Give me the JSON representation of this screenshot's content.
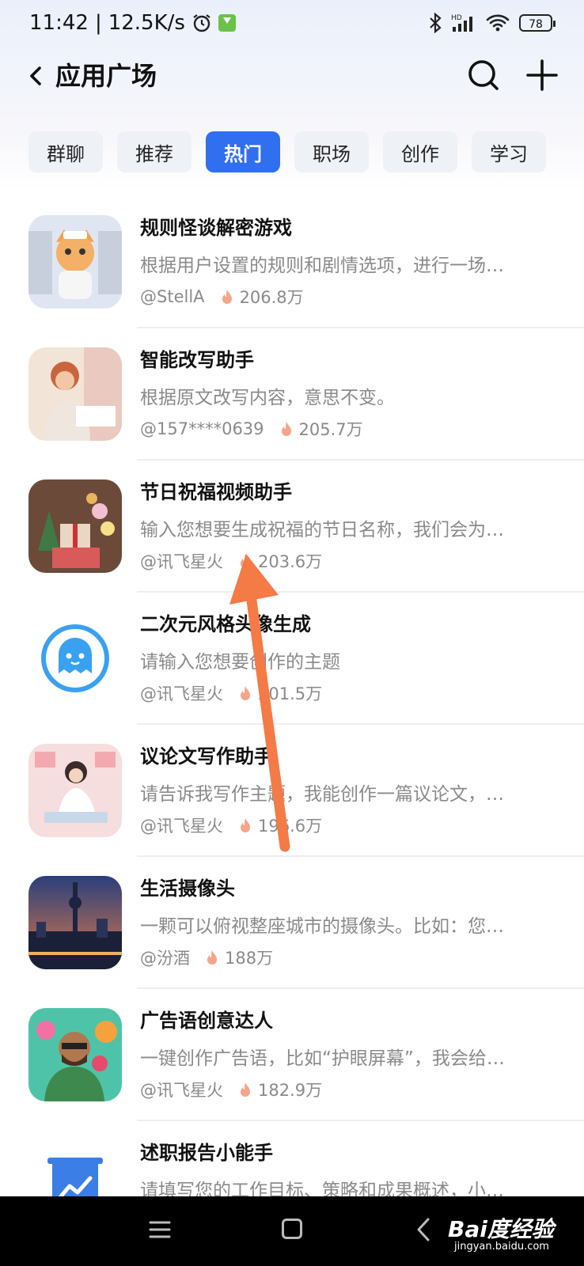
{
  "status_bar": {
    "time": "11:42",
    "net_speed": "12.5K/s",
    "battery": "78",
    "network_label": "HD"
  },
  "header": {
    "title": "应用广场"
  },
  "tabs": [
    {
      "label": "群聊",
      "active": false
    },
    {
      "label": "推荐",
      "active": false
    },
    {
      "label": "热门",
      "active": true
    },
    {
      "label": "职场",
      "active": false
    },
    {
      "label": "创作",
      "active": false
    },
    {
      "label": "学习",
      "active": false
    }
  ],
  "apps": [
    {
      "title": "规则怪谈解密游戏",
      "desc": "根据用户设置的规则和剧情选项，进行一场…",
      "author": "@StellA",
      "heat": "206.8万"
    },
    {
      "title": "智能改写助手",
      "desc": "根据原文改写内容，意思不变。",
      "author": "@157****0639",
      "heat": "205.7万"
    },
    {
      "title": "节日祝福视频助手",
      "desc": "输入您想要生成祝福的节日名称，我们会为…",
      "author": "@讯飞星火",
      "heat": "203.6万"
    },
    {
      "title": "二次元风格头像生成",
      "desc": "请输入您想要创作的主题",
      "author": "@讯飞星火",
      "heat": "201.5万"
    },
    {
      "title": "议论文写作助手",
      "desc": "请告诉我写作主题，我能创作一篇议论文，…",
      "author": "@讯飞星火",
      "heat": "196.6万"
    },
    {
      "title": "生活摄像头",
      "desc": "一颗可以俯视整座城市的摄像头。比如：您…",
      "author": "@汾酒",
      "heat": "188万"
    },
    {
      "title": "广告语创意达人",
      "desc": "一键创作广告语，比如“护眼屏幕”，我会给…",
      "author": "@讯飞星火",
      "heat": "182.9万"
    },
    {
      "title": "述职报告小能手",
      "desc": "请填写您的工作目标、策略和成果概述，小…",
      "author": "",
      "heat": ""
    }
  ],
  "watermark": {
    "brand": "Bai度经验",
    "url": "jingyan.baidu.com"
  },
  "colors": {
    "accent": "#2f6ff0",
    "flame": "#f5a58a",
    "arrow": "#f47a46"
  }
}
